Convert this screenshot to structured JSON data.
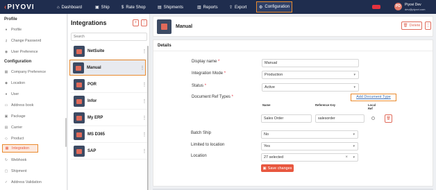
{
  "app": {
    "logo": "PIYOVI",
    "nav": [
      {
        "label": "Dashboard",
        "icon": "home-icon"
      },
      {
        "label": "Ship",
        "icon": "truck-icon"
      },
      {
        "label": "Rate Shop",
        "icon": "dollar-icon"
      },
      {
        "label": "Shipments",
        "icon": "box-icon"
      },
      {
        "label": "Reports",
        "icon": "bar-chart-icon"
      },
      {
        "label": "Export",
        "icon": "export-icon"
      },
      {
        "label": "Configuration",
        "icon": "gear-icon"
      }
    ],
    "user": {
      "initials": "PD",
      "name": "Piyovi Dev",
      "email": "dev@piyovi.com"
    },
    "accent": "#e8573f",
    "highlight": "#e98a2d",
    "nav_bg": "#1f2d4e"
  },
  "sidebar": {
    "sections": [
      {
        "title": "Profile",
        "items": [
          "Profile",
          "Change Password",
          "User Preference"
        ]
      },
      {
        "title": "Configuration",
        "items": [
          "Company Preference",
          "Location",
          "User",
          "Address book",
          "Package",
          "Carrier",
          "Product",
          "Integration",
          "Webhook",
          "Shipment",
          "Address Validation"
        ]
      }
    ],
    "active": "Integration"
  },
  "integrations": {
    "title": "Integrations",
    "search_placeholder": "Search",
    "items": [
      "NetSuite",
      "Manual",
      "POR",
      "Infor",
      "My ERP",
      "MS D365",
      "SAP"
    ],
    "selected": "Manual"
  },
  "detail": {
    "title": "Manual",
    "delete_label": "Delete",
    "section_title": "Details",
    "fields": {
      "display_name": {
        "label": "Display name",
        "value": "Manual"
      },
      "integration_mode": {
        "label": "Integration Mode",
        "value": "Production"
      },
      "status": {
        "label": "Status",
        "value": "Active"
      },
      "doc_ref_types": {
        "label": "Document Ref Types"
      },
      "batch_ship": {
        "label": "Batch Ship",
        "value": "No"
      },
      "limited_to_location": {
        "label": "Limited to location",
        "value": "Yes"
      },
      "location": {
        "label": "Location",
        "value": "27 selected"
      }
    },
    "add_document_type": "Add Document Type",
    "doc_table": {
      "headers": [
        "Name",
        "Reference Key",
        "Local Ref"
      ],
      "rows": [
        {
          "name": "Sales Order",
          "key": "salesorder"
        }
      ]
    },
    "save_label": "Save changes",
    "required_mark": "*"
  }
}
